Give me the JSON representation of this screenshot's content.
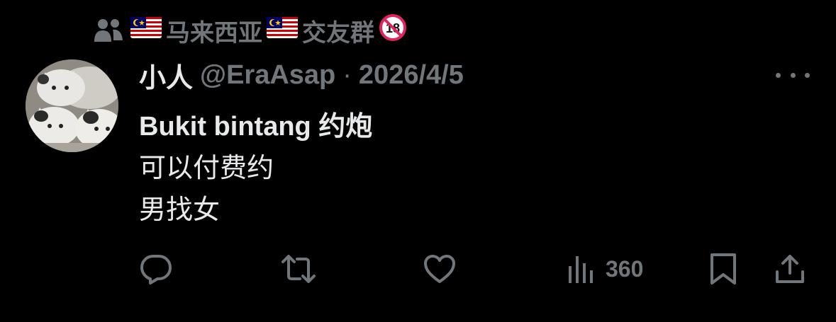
{
  "social_context": {
    "icon": "people-icon",
    "group_name": "马来西亚",
    "group_suffix": "交友群",
    "flag_emoji": "malaysia-flag",
    "badge_emoji": "no-under-18-icon"
  },
  "tweet": {
    "author": {
      "display_name": "小人",
      "handle": "@EraAsap",
      "avatar": "cat-mochi-avatar"
    },
    "separator": "·",
    "date": "2026/4/5",
    "body_lines": [
      "Bukit bintang 约炮",
      "可以付费约",
      "男找女"
    ]
  },
  "actions": {
    "reply": "reply-icon",
    "repost": "repost-icon",
    "like": "like-icon",
    "views_icon": "views-icon",
    "views_count": "360",
    "bookmark": "bookmark-icon",
    "share": "share-icon"
  },
  "colors": {
    "background": "#000000",
    "primary_text": "#e7e9ea",
    "secondary_text": "#71767b"
  }
}
